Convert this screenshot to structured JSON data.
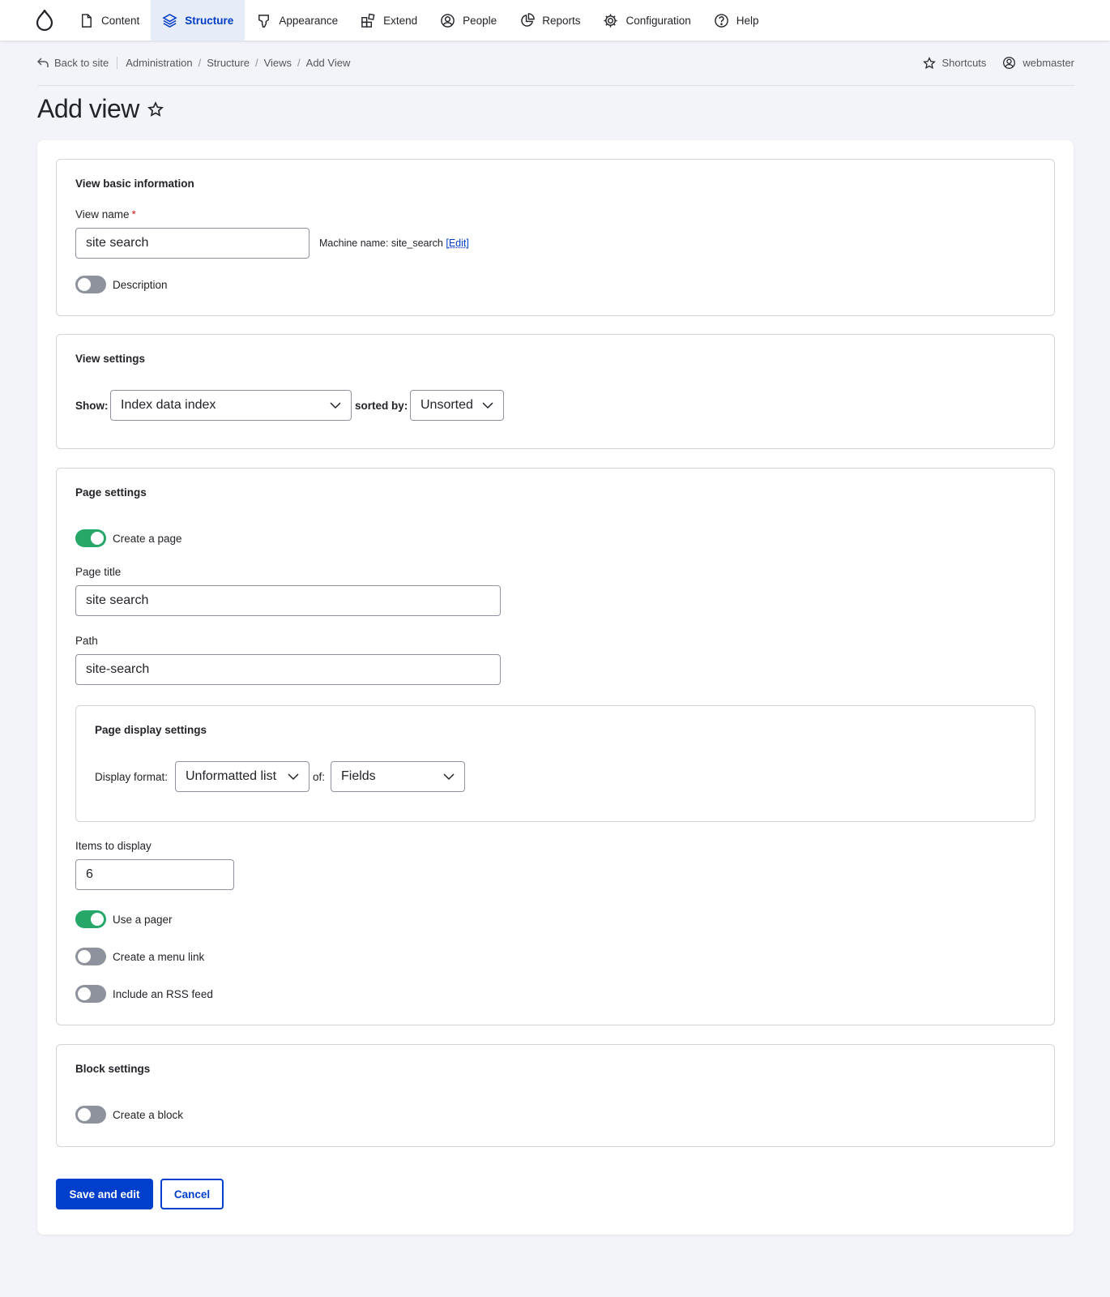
{
  "toolbar": {
    "items": [
      {
        "label": "Content",
        "icon": "file-icon"
      },
      {
        "label": "Structure",
        "icon": "layers-icon",
        "active": true
      },
      {
        "label": "Appearance",
        "icon": "brush-icon"
      },
      {
        "label": "Extend",
        "icon": "puzzle-icon"
      },
      {
        "label": "People",
        "icon": "person-icon"
      },
      {
        "label": "Reports",
        "icon": "pie-chart-icon"
      },
      {
        "label": "Configuration",
        "icon": "gear-icon"
      },
      {
        "label": "Help",
        "icon": "help-icon"
      }
    ]
  },
  "breadcrumb": {
    "back": "Back to site",
    "items": [
      "Administration",
      "Structure",
      "Views",
      "Add View"
    ],
    "shortcuts": "Shortcuts",
    "user": "webmaster"
  },
  "page": {
    "title": "Add view"
  },
  "basic": {
    "legend": "View basic information",
    "view_name_label": "View name",
    "required_mark": "*",
    "view_name_value": "site search",
    "machine_name_prefix": "Machine name: site_search",
    "machine_name_edit": "Edit",
    "description_label": "Description"
  },
  "view_settings": {
    "legend": "View settings",
    "show_label": "Show:",
    "show_value": "Index data index",
    "sorted_label": "sorted by:",
    "sorted_value": "Unsorted"
  },
  "page_settings": {
    "legend": "Page settings",
    "create_page_label": "Create a page",
    "page_title_label": "Page title",
    "page_title_value": "site search",
    "path_label": "Path",
    "path_value": "site-search",
    "display": {
      "legend": "Page display settings",
      "format_label": "Display format:",
      "format_value": "Unformatted list",
      "of_label": "of:",
      "of_value": "Fields"
    },
    "items_label": "Items to display",
    "items_value": "6",
    "pager_label": "Use a pager",
    "menu_link_label": "Create a menu link",
    "rss_label": "Include an RSS feed"
  },
  "block_settings": {
    "legend": "Block settings",
    "create_block_label": "Create a block"
  },
  "actions": {
    "save": "Save and edit",
    "cancel": "Cancel"
  },
  "colors": {
    "accent": "#003ecc",
    "toggle_on": "#26a769",
    "toggle_off": "#8e929c",
    "required": "#d72222"
  }
}
